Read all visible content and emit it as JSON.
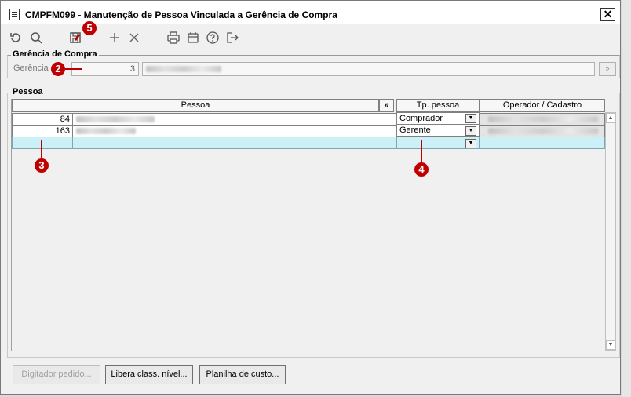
{
  "window": {
    "title": "CMPFM099 - Manutenção de Pessoa Vinculada a Gerência de Compra",
    "close_label": "✕"
  },
  "toolbar": {
    "items": [
      "undo-icon",
      "search-icon",
      "save-icon",
      "add-icon",
      "delete-icon",
      "print-icon",
      "calendar-icon",
      "help-icon",
      "exit-icon"
    ]
  },
  "gerencia_group": {
    "title": "Gerência de Compra",
    "label": "Gerência",
    "code_value": "3",
    "lookup_label": "»"
  },
  "pessoa_group": {
    "title": "Pessoa",
    "columns": {
      "pessoa": "Pessoa",
      "expand": "»",
      "tipo": "Tp. pessoa",
      "operador": "Operador / Cadastro"
    },
    "rows": [
      {
        "code": "84",
        "tipo": "Comprador"
      },
      {
        "code": "163",
        "tipo": "Gerente"
      },
      {
        "code": "",
        "tipo": ""
      }
    ]
  },
  "buttons": {
    "digitador": "Digitador pedido...",
    "libera": "Libera class. nível...",
    "planilha": "Planilha de custo..."
  },
  "markers": {
    "m2": "2",
    "m3": "3",
    "m4": "4",
    "m5": "5"
  },
  "colors": {
    "marker": "#c00000",
    "selected_row": "#ccf0f7"
  }
}
